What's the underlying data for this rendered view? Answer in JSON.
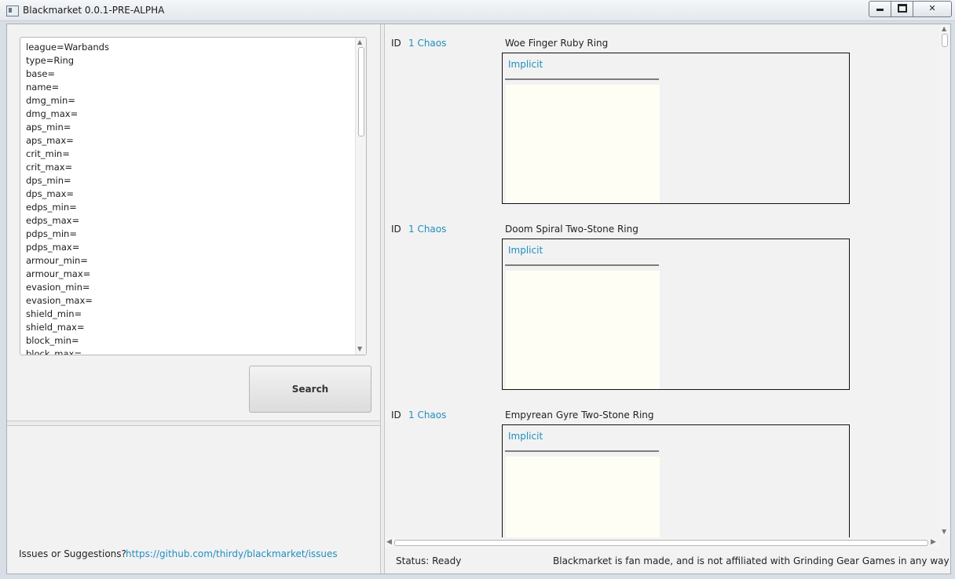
{
  "window": {
    "title": "Blackmarket 0.0.1-PRE-ALPHA",
    "minimize_label": "–",
    "maximize_label": "□",
    "close_label": "✕"
  },
  "query": {
    "lines": [
      "league=Warbands",
      "type=Ring",
      "base=",
      "name=",
      "dmg_min=",
      "dmg_max=",
      "aps_min=",
      "aps_max=",
      "crit_min=",
      "crit_max=",
      "dps_min=",
      "dps_max=",
      "edps_min=",
      "edps_max=",
      "pdps_min=",
      "pdps_max=",
      "armour_min=",
      "armour_max=",
      "evasion_min=",
      "evasion_max=",
      "shield_min=",
      "shield_max=",
      "block_min=",
      "block_max="
    ]
  },
  "search_button": {
    "label": "Search"
  },
  "footer": {
    "issues_label": "Issues or Suggestions?",
    "issues_link": "https://github.com/thirdy/blackmarket/issues"
  },
  "results": [
    {
      "id_label": "ID",
      "price": "1 Chaos",
      "name": "Woe Finger Ruby Ring",
      "implicit_label": "Implicit"
    },
    {
      "id_label": "ID",
      "price": "1 Chaos",
      "name": "Doom Spiral Two-Stone Ring",
      "implicit_label": "Implicit"
    },
    {
      "id_label": "ID",
      "price": "1 Chaos",
      "name": "Empyrean Gyre Two-Stone Ring",
      "implicit_label": "Implicit"
    }
  ],
  "status": {
    "text": "Status: Ready",
    "disclaimer": "Blackmarket is fan made, and is not affiliated with Grinding Gear Games in any way"
  },
  "icons": {
    "app": "app-window-icon",
    "scroll_up": "chevron-up-icon",
    "scroll_down": "chevron-down-icon",
    "scroll_left": "chevron-left-icon",
    "scroll_right": "chevron-right-icon"
  },
  "colors": {
    "link": "#1f8fc0",
    "mods_background": "#fffef4"
  }
}
